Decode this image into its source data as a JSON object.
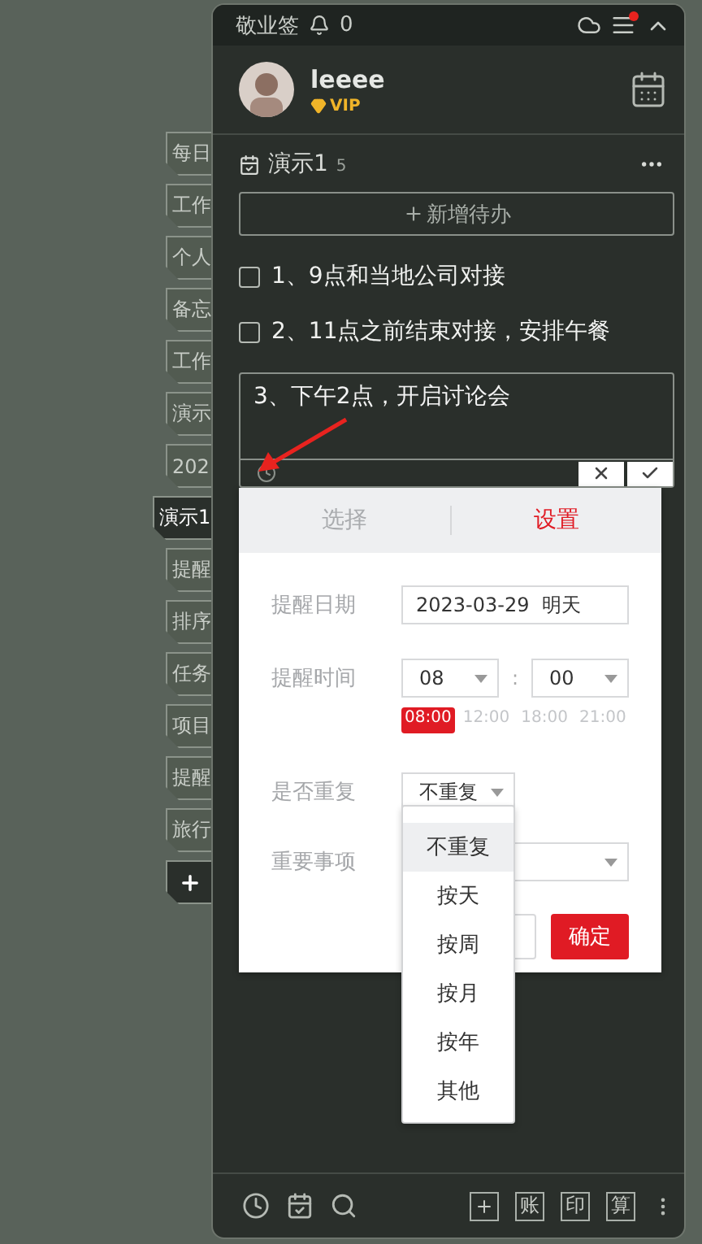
{
  "header": {
    "app_name": "敬业签",
    "notification_count": "0",
    "has_unread": true
  },
  "profile": {
    "username": "leeee",
    "badge": "VIP"
  },
  "side_tabs": [
    {
      "label": "每日",
      "selected": false
    },
    {
      "label": "工作",
      "selected": false
    },
    {
      "label": "个人",
      "selected": false
    },
    {
      "label": "备忘",
      "selected": false
    },
    {
      "label": "工作",
      "selected": false
    },
    {
      "label": "演示",
      "selected": false
    },
    {
      "label": "202",
      "selected": false
    },
    {
      "label": "演示1",
      "selected": true
    },
    {
      "label": "提醒",
      "selected": false
    },
    {
      "label": "排序",
      "selected": false
    },
    {
      "label": "任务",
      "selected": false
    },
    {
      "label": "项目",
      "selected": false
    },
    {
      "label": "提醒",
      "selected": false
    },
    {
      "label": "旅行",
      "selected": false
    }
  ],
  "list": {
    "title": "演示1",
    "count": "5",
    "add_button": "新增待办",
    "items": [
      {
        "text": "1、9点和当地公司对接",
        "checked": false
      },
      {
        "text": "2、11点之前结束对接，安排午餐",
        "checked": false
      }
    ],
    "editing": {
      "text": "3、下午2点，开启讨论会"
    }
  },
  "reminder_popup": {
    "tabs": [
      {
        "label": "选择",
        "selected": false
      },
      {
        "label": "设置",
        "selected": true
      }
    ],
    "date_label": "提醒日期",
    "date_value": "2023-03-29  明天",
    "time_label": "提醒时间",
    "hour": "08",
    "separator": ":",
    "minute": "00",
    "quick_times": [
      {
        "label": "08:00",
        "selected": true
      },
      {
        "label": "12:00",
        "selected": false
      },
      {
        "label": "18:00",
        "selected": false
      },
      {
        "label": "21:00",
        "selected": false
      }
    ],
    "repeat_label": "是否重复",
    "repeat_value": "不重复",
    "important_label": "重要事项",
    "confirm_button": "确定",
    "repeat_options": [
      {
        "label": "不重复",
        "selected": true
      },
      {
        "label": "按天",
        "selected": false
      },
      {
        "label": "按周",
        "selected": false
      },
      {
        "label": "按月",
        "selected": false
      },
      {
        "label": "按年",
        "selected": false
      },
      {
        "label": "其他",
        "selected": false
      }
    ]
  },
  "footer": {
    "shortcuts": [
      "账",
      "印",
      "算"
    ]
  }
}
